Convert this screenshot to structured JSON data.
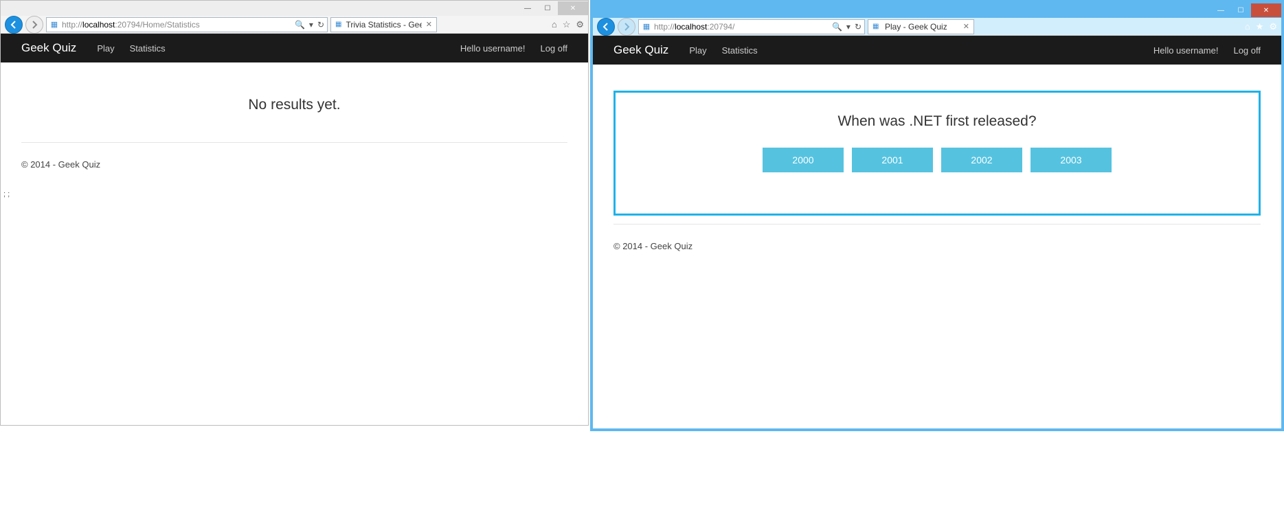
{
  "left": {
    "titlebar": {
      "min": "—",
      "max": "☐",
      "close": "✕"
    },
    "toolbar": {
      "url_prefix": "http://",
      "url_host": "localhost",
      "url_rest": ":20794/Home/Statistics",
      "search_glyph": "🔍",
      "refresh_glyph": "↻",
      "tab_title": "Trivia Statistics - Geek Quiz",
      "home_glyph": "⌂",
      "star_glyph": "☆",
      "gear_glyph": "⚙"
    },
    "navbar": {
      "brand": "Geek Quiz",
      "play": "Play",
      "statistics": "Statistics",
      "hello": "Hello username!",
      "logoff": "Log off"
    },
    "body": {
      "no_results": "No results yet.",
      "footer": "© 2014 - Geek Quiz",
      "stray": "; ;"
    }
  },
  "right": {
    "titlebar": {
      "min": "—",
      "max": "☐",
      "close": "✕"
    },
    "toolbar": {
      "url_prefix": "http://",
      "url_host": "localhost",
      "url_rest": ":20794/",
      "search_glyph": "🔍",
      "refresh_glyph": "↻",
      "tab_title": "Play - Geek Quiz",
      "home_glyph": "⌂",
      "star_glyph": "★",
      "gear_glyph": "⚙"
    },
    "navbar": {
      "brand": "Geek Quiz",
      "play": "Play",
      "statistics": "Statistics",
      "hello": "Hello username!",
      "logoff": "Log off"
    },
    "quiz": {
      "question": "When was .NET first released?",
      "answers": [
        "2000",
        "2001",
        "2002",
        "2003"
      ]
    },
    "footer": "© 2014 - Geek Quiz"
  }
}
